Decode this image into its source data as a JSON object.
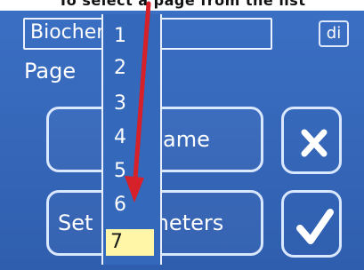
{
  "header": {
    "caption": "To select a page from the list"
  },
  "form": {
    "name_value": "Biochem",
    "di_label": "di",
    "page_label": "Page"
  },
  "buttons": {
    "name_label": "ame",
    "set_parameters_label": "Set parameters",
    "cancel_icon": "x-icon",
    "ok_icon": "check-icon"
  },
  "page_list": {
    "items": [
      "1",
      "2",
      "3",
      "4",
      "5",
      "6",
      "7"
    ],
    "selected": "7"
  },
  "annotation": {
    "arrow_color": "#d6202a",
    "arrow_icon": "red-arrow"
  },
  "colors": {
    "background": "#3566b8",
    "selected_item": "#fff6a8",
    "border": "#d9e7ff"
  }
}
